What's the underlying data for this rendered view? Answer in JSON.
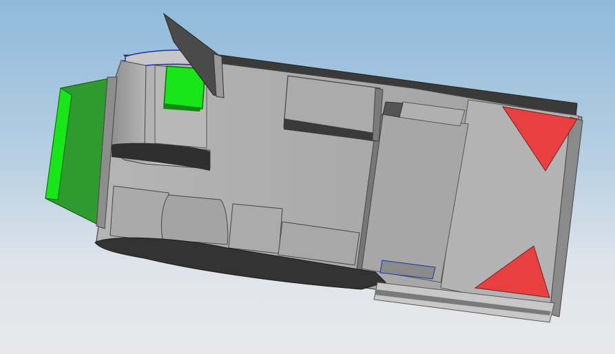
{
  "viewport": {
    "background_top": "#8fb9da",
    "background_bottom": "#e8e8ea"
  },
  "model": {
    "body_color": "#a9a9a9",
    "body_shade": "#8c8c8c",
    "track_color": "#3a3a3a",
    "panel_green": "#2f9a2f",
    "block_green": "#19e619",
    "triangle_red": "#e84040",
    "edge_blue": "#1b2fb0",
    "parts": [
      {
        "name": "chassis-body",
        "label": ""
      },
      {
        "name": "left-track",
        "label": ""
      },
      {
        "name": "right-track",
        "label": ""
      },
      {
        "name": "front-green-panel",
        "label": ""
      },
      {
        "name": "green-block",
        "label": ""
      },
      {
        "name": "rear-red-triangle-top",
        "label": ""
      },
      {
        "name": "rear-red-triangle-bottom",
        "label": ""
      },
      {
        "name": "raised-flap",
        "label": ""
      },
      {
        "name": "center-box",
        "label": ""
      },
      {
        "name": "side-rail",
        "label": ""
      }
    ]
  }
}
